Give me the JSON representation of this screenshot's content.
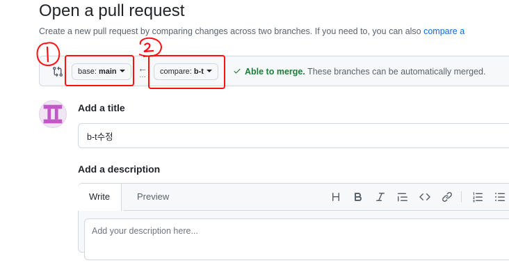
{
  "header": {
    "title": "Open a pull request",
    "subtitle_text": "Create a new pull request by comparing changes across two branches. If you need to, you can also ",
    "subtitle_link": "compare a"
  },
  "range": {
    "base_prefix": "base: ",
    "base_branch": "main",
    "compare_prefix": "compare: ",
    "compare_branch": "b-t",
    "merge_ok": "Able to merge.",
    "merge_detail": " These branches can be automatically merged."
  },
  "annotations": {
    "one": "1",
    "two": "2",
    "color": "#ff1010"
  },
  "form": {
    "title_label": "Add a title",
    "title_value": "b-t수정",
    "desc_label": "Add a description",
    "desc_placeholder": "Add your description here..."
  },
  "editor": {
    "tabs": [
      "Write",
      "Preview"
    ],
    "toolbar_icons": [
      "heading-icon",
      "bold-icon",
      "italic-icon",
      "quote-icon",
      "code-icon",
      "link-icon",
      "ordered-list-icon",
      "unordered-list-icon"
    ]
  },
  "colors": {
    "link": "#0969da",
    "success": "#1a7f37",
    "avatar": "#c257c8"
  }
}
